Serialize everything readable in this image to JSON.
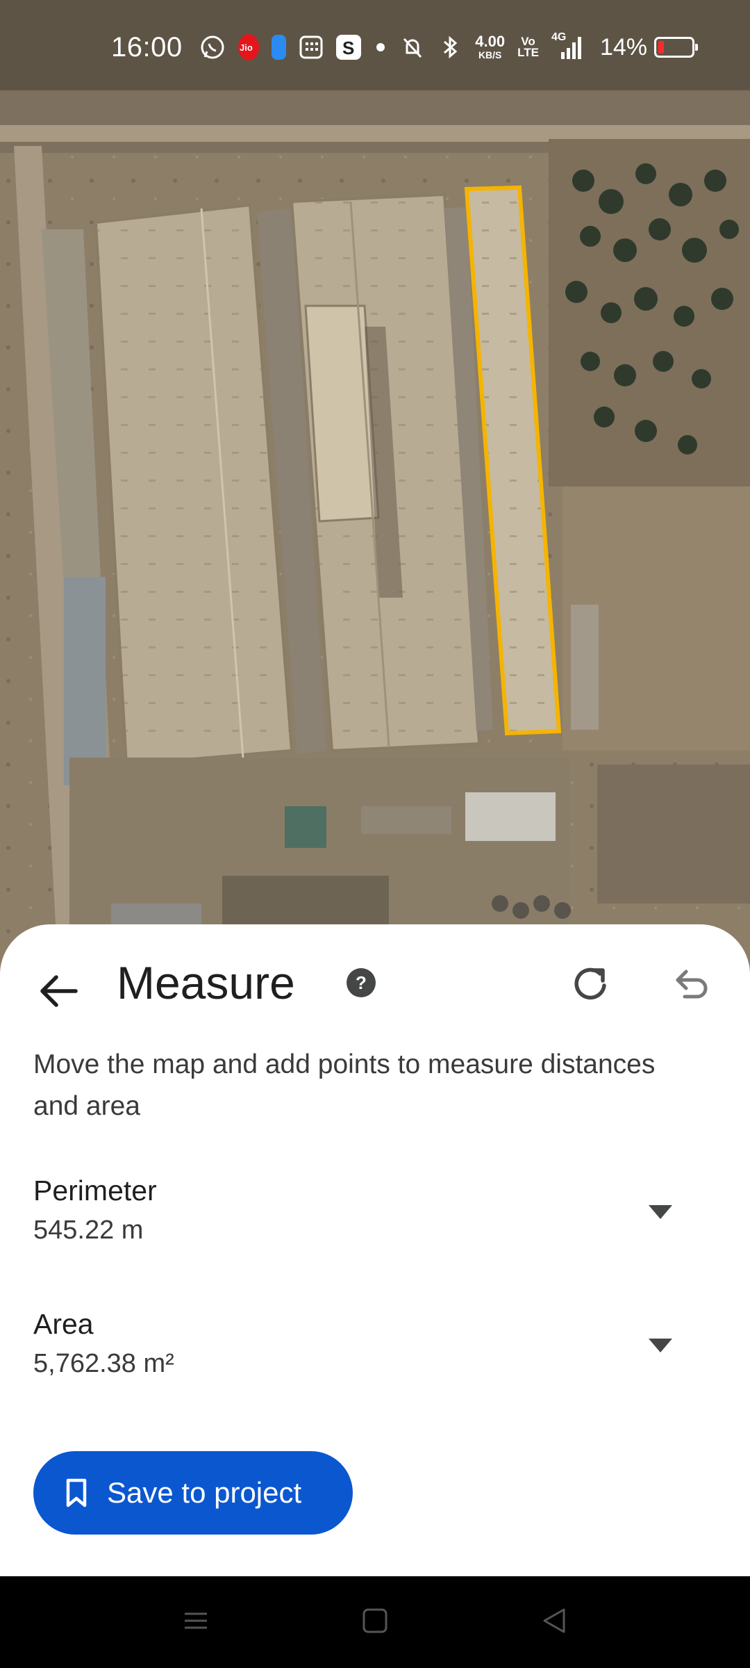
{
  "status_bar": {
    "time": "16:00",
    "data_speed_value": "4.00",
    "data_speed_unit": "KB/S",
    "volte_top": "Vo",
    "volte_bottom": "LTE",
    "network": "4G",
    "battery": "14%",
    "icons": [
      "whatsapp-icon",
      "jio-icon",
      "app-icon",
      "calculator-icon",
      "s-app-icon",
      "dot-icon",
      "mute-icon",
      "bluetooth-icon",
      "signal-icon",
      "battery-icon"
    ]
  },
  "map": {
    "type": "satellite",
    "highlight_color": "#f5b400"
  },
  "sheet": {
    "title": "Measure",
    "instructions": "Move the map and add points to measure distances and area",
    "metrics": [
      {
        "label": "Perimeter",
        "value": "545.22 m"
      },
      {
        "label": "Area",
        "value": "5,762.38 m²"
      }
    ],
    "save_label": "Save to project",
    "accent_color": "#0b57d0"
  },
  "nav_bar": {
    "items": [
      "menu-icon",
      "home-icon",
      "back-icon"
    ]
  }
}
